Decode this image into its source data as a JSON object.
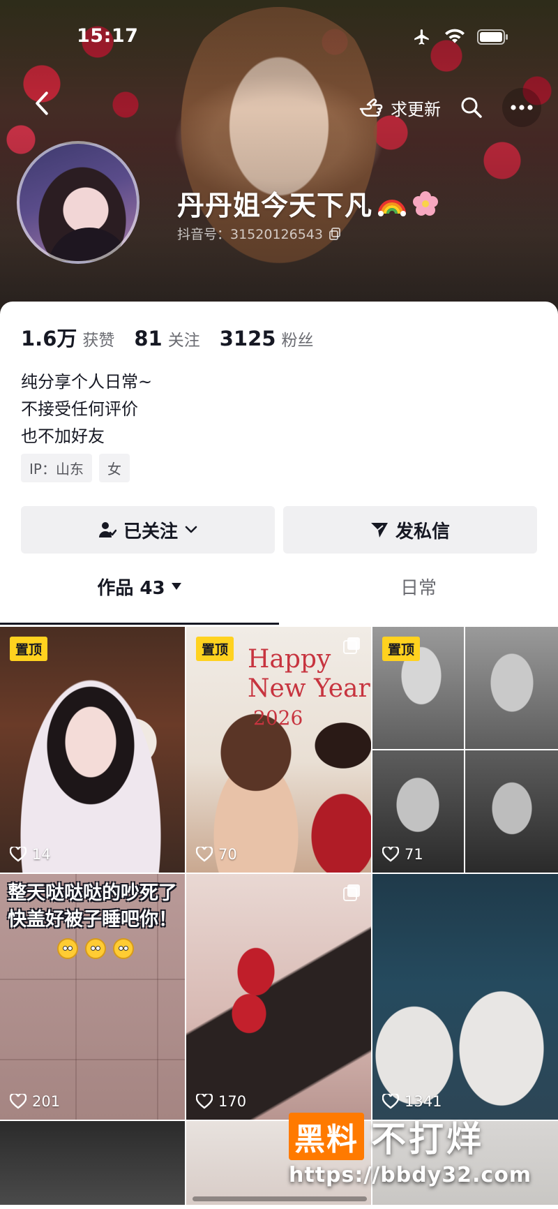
{
  "status_bar": {
    "time": "15:17"
  },
  "header": {
    "request_update_label": "求更新",
    "name": "丹丹姐今天下凡",
    "douyin_id": "抖音号：31520126543"
  },
  "stats": [
    {
      "value": "1.6万",
      "label": "获赞"
    },
    {
      "value": "81",
      "label": "关注"
    },
    {
      "value": "3125",
      "label": "粉丝"
    }
  ],
  "bio": [
    "纯分享个人日常~",
    "不接受任何评价",
    "也不加好友"
  ],
  "tags": [
    "IP：山东",
    "女"
  ],
  "actions": {
    "follow_label": "已关注",
    "message_label": "发私信"
  },
  "tabs": {
    "works_label": "作品 43",
    "daily_label": "日常"
  },
  "grid": {
    "pin_label": "置顶",
    "items": [
      {
        "likes": "14"
      },
      {
        "likes": "70"
      },
      {
        "likes": "71"
      },
      {
        "likes": "201"
      },
      {
        "likes": "170"
      },
      {
        "likes": "1341"
      }
    ],
    "overlay_text_1": "整天哒哒哒的吵死了",
    "overlay_text_2": "快盖好被子睡吧你！",
    "happy_line_1": "Happy",
    "happy_line_2": "New Year",
    "happy_year": "2026"
  },
  "watermark": {
    "box_text": "黑料",
    "main_text": "不打烊",
    "url": "https://bbdy32.com"
  },
  "colors": {
    "accent_yellow": "#ffd21f",
    "watermark_orange": "#ff7a00",
    "text_primary": "#161823",
    "text_secondary": "#6b6c72"
  }
}
